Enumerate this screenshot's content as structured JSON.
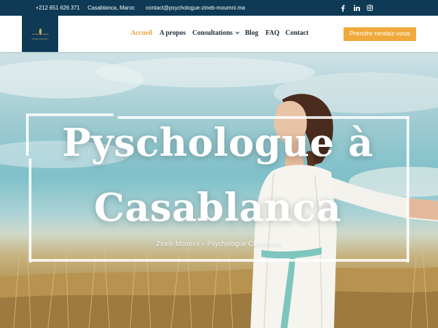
{
  "topbar": {
    "phone": "+212 651 626 371",
    "city": "Casablanca, Maroc",
    "email": "contact@psychologue-zineb-moumni.ma",
    "social": [
      "facebook-icon",
      "linkedin-icon",
      "instagram-icon"
    ]
  },
  "header": {
    "logo_tag": "ZINEB MOUMNI",
    "nav": [
      {
        "label": "Accueil",
        "active": true
      },
      {
        "label": "A propos"
      },
      {
        "label": "Consultations",
        "dropdown": true
      },
      {
        "label": "Blog"
      },
      {
        "label": "FAQ"
      },
      {
        "label": "Contact"
      }
    ],
    "cta_label": "Prendre rendez-vous"
  },
  "hero": {
    "title_line1": "Pyschologue à",
    "title_line2": "Casablanca",
    "subtitle": "Zineb Moumni – Psychologue Clinicienne"
  },
  "colors": {
    "navy": "#0e3a55",
    "accent": "#f0a93a",
    "nav_active": "#e9a83a",
    "nav_text": "#1c2b3a"
  }
}
